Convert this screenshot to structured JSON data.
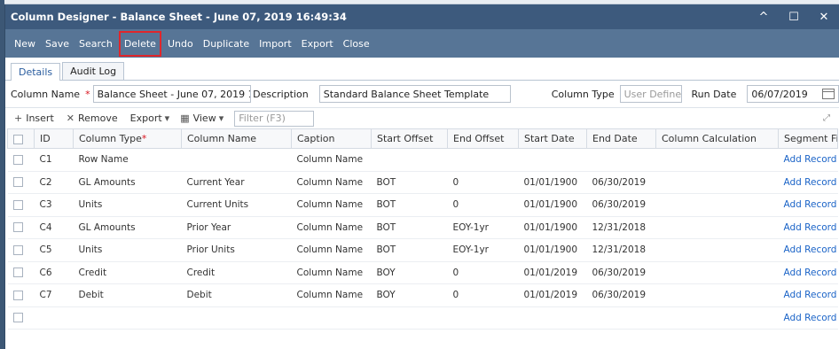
{
  "window": {
    "title": "Column Designer - Balance Sheet - June 07, 2019 16:49:34",
    "controls": {
      "minimize": "^",
      "maximize": "☐",
      "close": "✕"
    }
  },
  "toolbar": {
    "buttons": [
      "New",
      "Save",
      "Search",
      "Delete",
      "Undo",
      "Duplicate",
      "Import",
      "Export",
      "Close"
    ],
    "highlighted": "Delete"
  },
  "tabs": [
    {
      "label": "Details",
      "active": true
    },
    {
      "label": "Audit Log",
      "active": false
    }
  ],
  "form": {
    "column_name_label": "Column Name",
    "column_name_value": "Balance Sheet - June 07, 2019 16:49",
    "description_label": "Description",
    "description_value": "Standard Balance Sheet Template",
    "column_type_label": "Column Type",
    "column_type_placeholder": "User Defined",
    "run_date_label": "Run Date",
    "run_date_value": "06/07/2019"
  },
  "grid_toolbar": {
    "insert": "Insert",
    "remove": "Remove",
    "export": "Export",
    "view": "View",
    "filter_placeholder": "Filter (F3)"
  },
  "grid": {
    "headers": [
      "ID",
      "Column Type",
      "Column Name",
      "Caption",
      "Start Offset",
      "End Offset",
      "Start Date",
      "End Date",
      "Column Calculation",
      "Segment Filter"
    ],
    "rows": [
      {
        "id": "C1",
        "column_type": "Row Name",
        "column_name": "",
        "caption": "Column Name",
        "start_offset": "",
        "end_offset": "",
        "start_date": "",
        "end_date": "",
        "calc": "",
        "segment": "Add Record"
      },
      {
        "id": "C2",
        "column_type": "GL Amounts",
        "column_name": "Current Year",
        "caption": "Column Name",
        "start_offset": "BOT",
        "end_offset": "0",
        "start_date": "01/01/1900",
        "end_date": "06/30/2019",
        "calc": "",
        "segment": "Add Record"
      },
      {
        "id": "C3",
        "column_type": "Units",
        "column_name": "Current Units",
        "caption": "Column Name",
        "start_offset": "BOT",
        "end_offset": "0",
        "start_date": "01/01/1900",
        "end_date": "06/30/2019",
        "calc": "",
        "segment": "Add Record"
      },
      {
        "id": "C4",
        "column_type": "GL Amounts",
        "column_name": "Prior Year",
        "caption": "Column Name",
        "start_offset": "BOT",
        "end_offset": "EOY-1yr",
        "start_date": "01/01/1900",
        "end_date": "12/31/2018",
        "calc": "",
        "segment": "Add Record"
      },
      {
        "id": "C5",
        "column_type": "Units",
        "column_name": "Prior Units",
        "caption": "Column Name",
        "start_offset": "BOT",
        "end_offset": "EOY-1yr",
        "start_date": "01/01/1900",
        "end_date": "12/31/2018",
        "calc": "",
        "segment": "Add Record"
      },
      {
        "id": "C6",
        "column_type": "Credit",
        "column_name": "Credit",
        "caption": "Column Name",
        "start_offset": "BOY",
        "end_offset": "0",
        "start_date": "01/01/2019",
        "end_date": "06/30/2019",
        "calc": "",
        "segment": "Add Record"
      },
      {
        "id": "C7",
        "column_type": "Debit",
        "column_name": "Debit",
        "caption": "Column Name",
        "start_offset": "BOY",
        "end_offset": "0",
        "start_date": "01/01/2019",
        "end_date": "06/30/2019",
        "calc": "",
        "segment": "Add Record"
      },
      {
        "id": "",
        "column_type": "",
        "column_name": "",
        "caption": "",
        "start_offset": "",
        "end_offset": "",
        "start_date": "",
        "end_date": "",
        "calc": "",
        "segment": "Add Record"
      }
    ]
  },
  "colors": {
    "titlebar": "#3d5a7d",
    "toolbar": "#577596",
    "highlight_border": "#e0262b",
    "link": "#1a63c7",
    "required": "#d9141e"
  }
}
